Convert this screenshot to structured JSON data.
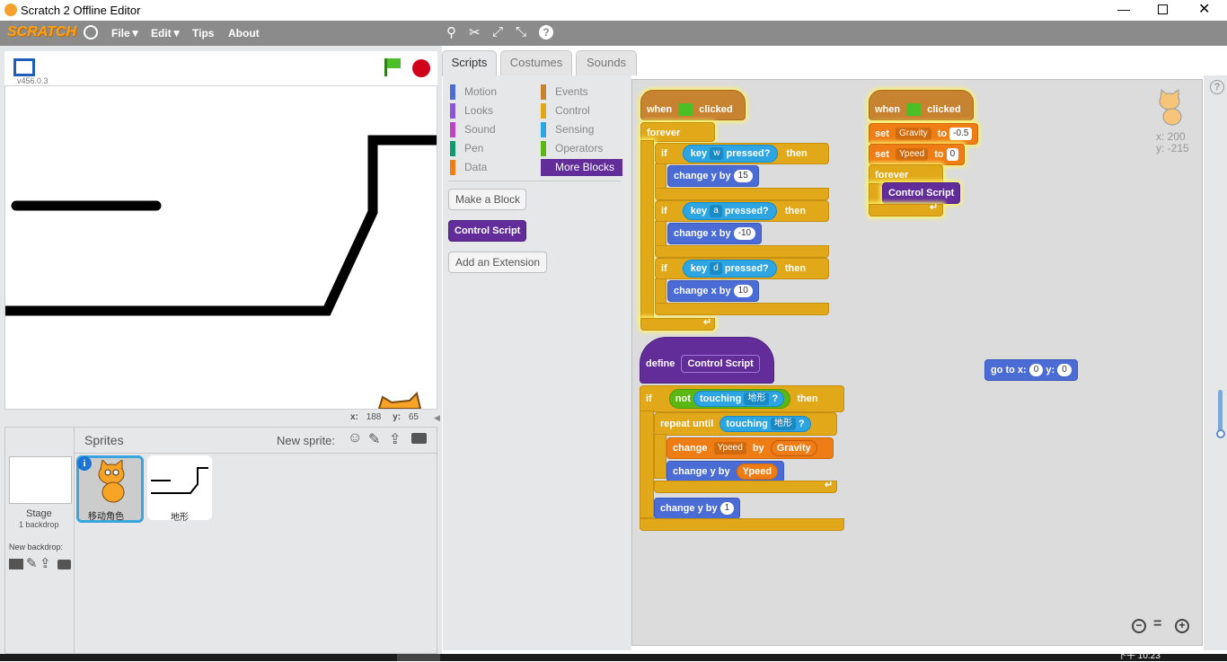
{
  "window": {
    "title": "Scratch 2 Offline Editor"
  },
  "menu": {
    "logo": "SCRATCH",
    "file": "File▼",
    "edit": "Edit▼",
    "tips": "Tips",
    "about": "About"
  },
  "stage": {
    "version": "v456.0.3",
    "coords": {
      "x_label": "x:",
      "x": "188",
      "y_label": "y:",
      "y": "65"
    }
  },
  "sprites": {
    "title": "Sprites",
    "new_sprite": "New sprite:",
    "stage_label": "Stage",
    "stage_sub": "1 backdrop",
    "new_backdrop": "New backdrop:",
    "items": [
      {
        "name": "移动角色"
      },
      {
        "name": "地形"
      }
    ]
  },
  "tabs": {
    "scripts": "Scripts",
    "costumes": "Costumes",
    "sounds": "Sounds"
  },
  "palette": {
    "categories": [
      {
        "label": "Motion",
        "color": "#4a6cd4"
      },
      {
        "label": "Events",
        "color": "#c88330"
      },
      {
        "label": "Looks",
        "color": "#8a55d7"
      },
      {
        "label": "Control",
        "color": "#e1a91a"
      },
      {
        "label": "Sound",
        "color": "#bb42c3"
      },
      {
        "label": "Sensing",
        "color": "#2ca5e2"
      },
      {
        "label": "Pen",
        "color": "#0e9a6c"
      },
      {
        "label": "Operators",
        "color": "#5cb712"
      },
      {
        "label": "Data",
        "color": "#ee7d16"
      },
      {
        "label": "More Blocks",
        "color": "#632d99"
      }
    ],
    "make_block": "Make a Block",
    "custom_block": "Control Script",
    "add_extension": "Add an Extension"
  },
  "script_area": {
    "sprite_x": "x: 200",
    "sprite_y": "y: -215",
    "script1": {
      "hat": [
        "when",
        "clicked"
      ],
      "forever": "forever",
      "ifs": [
        {
          "if": "if",
          "key": "key",
          "keyval": "w",
          "pressed": "pressed?",
          "then": "then",
          "action": "change y by",
          "value": "15"
        },
        {
          "if": "if",
          "key": "key",
          "keyval": "a",
          "pressed": "pressed?",
          "then": "then",
          "action": "change x by",
          "value": "-10"
        },
        {
          "if": "if",
          "key": "key",
          "keyval": "d",
          "pressed": "pressed?",
          "then": "then",
          "action": "change x by",
          "value": "10"
        }
      ]
    },
    "script2": {
      "hat": [
        "when",
        "clicked"
      ],
      "set1": {
        "set": "set",
        "var": "Gravity",
        "to": "to",
        "value": "-0.5"
      },
      "set2": {
        "set": "set",
        "var": "Ypeed",
        "to": "to",
        "value": "0"
      },
      "forever": "forever",
      "call": "Control Script"
    },
    "script3": {
      "define": "define",
      "name": "Control Script",
      "if": "if",
      "not": "not",
      "touching": "touching",
      "target": "地形",
      "q": "?",
      "then": "then",
      "repeat_until": "repeat until",
      "change_var": "change",
      "var": "Ypeed",
      "by": "by",
      "by_var": "Gravity",
      "change_y": "change y by",
      "change_y_var": "Ypeed",
      "final_change": "change y by",
      "final_value": "1"
    },
    "goto": {
      "label": "go to x:",
      "x": "0",
      "y_label": "y:",
      "y": "0"
    }
  },
  "taskbar_time": "下午 10:23"
}
